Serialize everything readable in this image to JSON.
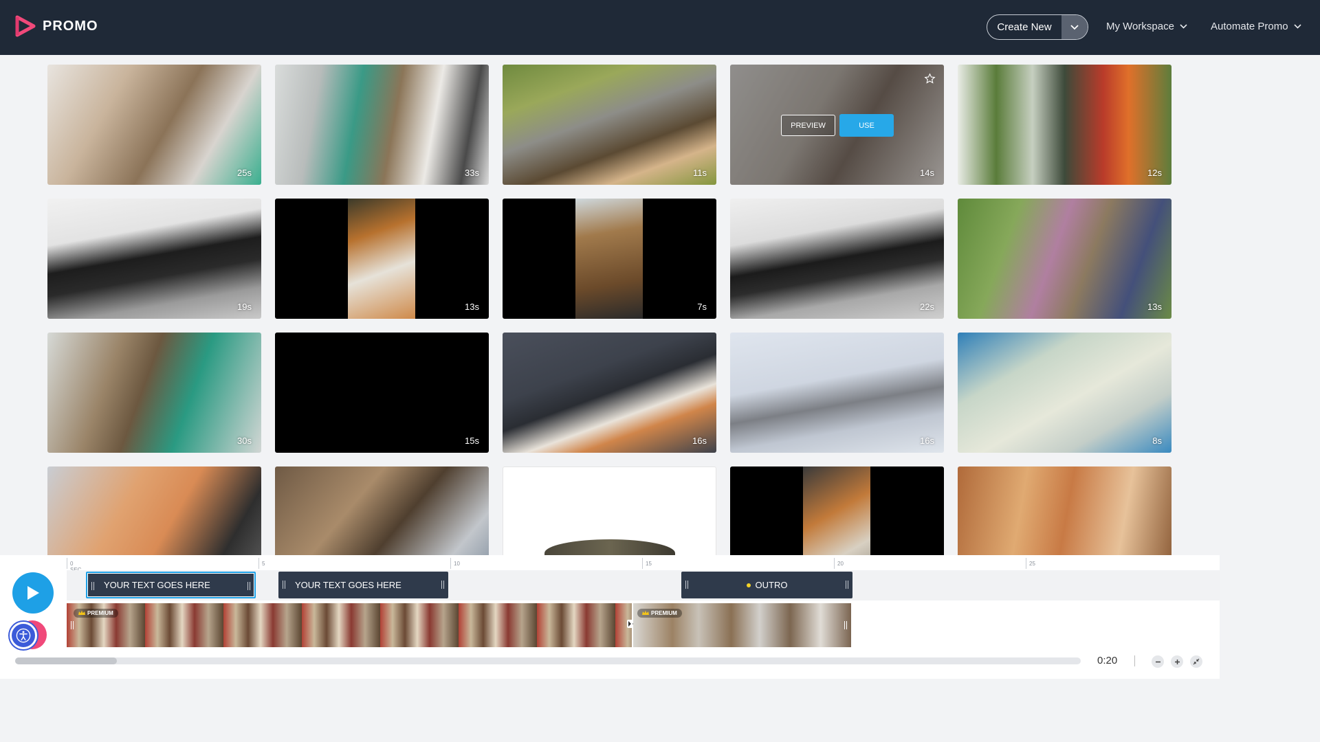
{
  "header": {
    "brand": "PROMO",
    "create_new": "Create New",
    "nav": [
      {
        "label": "My Workspace"
      },
      {
        "label": "Automate Promo"
      }
    ]
  },
  "hover_tile": {
    "preview": "PREVIEW",
    "use": "USE"
  },
  "tiles": [
    {
      "duration": "25s"
    },
    {
      "duration": "33s"
    },
    {
      "duration": "11s"
    },
    {
      "duration": "14s"
    },
    {
      "duration": "12s"
    },
    {
      "duration": "19s"
    },
    {
      "duration": "13s"
    },
    {
      "duration": "7s"
    },
    {
      "duration": "22s"
    },
    {
      "duration": "13s"
    },
    {
      "duration": "30s"
    },
    {
      "duration": "15s"
    },
    {
      "duration": "16s"
    },
    {
      "duration": "16s"
    },
    {
      "duration": "8s"
    },
    {
      "duration": ""
    },
    {
      "duration": ""
    },
    {
      "duration": ""
    },
    {
      "duration": ""
    },
    {
      "duration": ""
    }
  ],
  "timeline": {
    "ruler": [
      "0 SEC",
      "5",
      "10",
      "15",
      "20",
      "25"
    ],
    "text_clips": [
      {
        "label": "YOUR TEXT GOES HERE"
      },
      {
        "label": "YOUR TEXT GOES HERE"
      },
      {
        "label": "OUTRO"
      }
    ],
    "badges": [
      "PREMIUM",
      "PREMIUM"
    ],
    "time": "0:20"
  },
  "colors": {
    "header": "#1f2937",
    "accent": "#1ea0e6",
    "use_button": "#27a8e8",
    "brand_pink": "#f0497a",
    "outro_dot": "#f5d327"
  }
}
